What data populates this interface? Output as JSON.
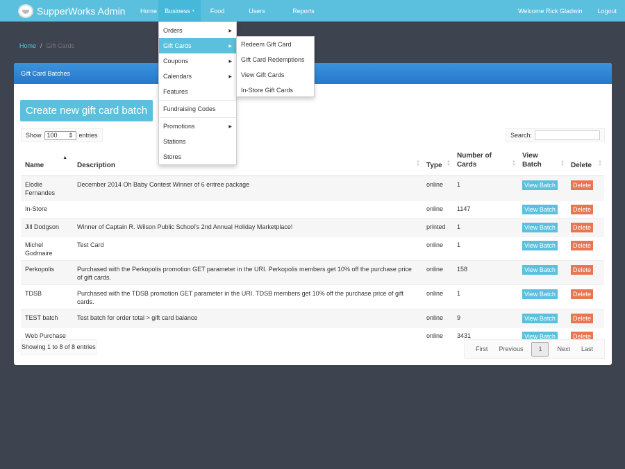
{
  "nav": {
    "brand": "SupperWorks Admin",
    "items": [
      "Home",
      "Business",
      "Food",
      "Users",
      "Reports"
    ],
    "welcome": "Welcome Rick Gladwin",
    "logout": "Logout"
  },
  "breadcrumb": {
    "home": "Home",
    "sep": "/",
    "current": "Gift Cards"
  },
  "panel": {
    "title": "Gift Card Batches",
    "create_label": "Create new gift card batch",
    "show_label": "Show",
    "entries_value": "100",
    "entries_label": "entries",
    "search_label": "Search:",
    "search_value": ""
  },
  "table": {
    "headers": [
      "Name",
      "Description",
      "Type",
      "Number of Cards",
      "View Batch",
      "Delete"
    ],
    "rows": [
      {
        "name": "Elodie Fernandes",
        "desc": "December 2014 Oh Baby Contest Winner of 6 entree package",
        "type": "online",
        "count": "1"
      },
      {
        "name": "In-Store",
        "desc": "",
        "type": "online",
        "count": "1147"
      },
      {
        "name": "Jill Dodgson",
        "desc": "Winner of Captain R. Wilson Public School's 2nd Annual Holiday Marketplace!",
        "type": "printed",
        "count": "1"
      },
      {
        "name": "Michel Godmaire",
        "desc": "Test Card",
        "type": "online",
        "count": "1"
      },
      {
        "name": "Perkopolis",
        "desc": "Purchased with the Perkopolis promotion GET parameter in the URI. Perkopolis members get 10% off the purchase price of gift cards.",
        "type": "online",
        "count": "158"
      },
      {
        "name": "TDSB",
        "desc": "Purchased with the TDSB promotion GET parameter in the URI. TDSB members get 10% off the purchase price of gift cards.",
        "type": "online",
        "count": "1"
      },
      {
        "name": "TEST batch",
        "desc": "Test batch for order total > gift card balance",
        "type": "online",
        "count": "9"
      },
      {
        "name": "Web Purchase",
        "desc": "",
        "type": "online",
        "count": "3431"
      }
    ],
    "view_label": "View Batch",
    "delete_label": "Delete"
  },
  "info": "Showing 1 to 8 of 8 entries",
  "pager": {
    "first": "First",
    "previous": "Previous",
    "current": "1",
    "next": "Next",
    "last": "Last"
  },
  "business_menu": [
    "Orders",
    "Gift Cards",
    "Coupons",
    "Calendars",
    "Features",
    "Fundraising Codes",
    "Promotions",
    "Stations",
    "Stores"
  ],
  "giftcards_submenu": [
    "Redeem Gift Card",
    "Gift Card Redemptions",
    "View Gift Cards",
    "In-Store Gift Cards"
  ],
  "colors": {
    "accent": "#5bc0de",
    "panel_header": "#2c85d6",
    "delete": "#e8764e",
    "background": "#3e4350"
  }
}
